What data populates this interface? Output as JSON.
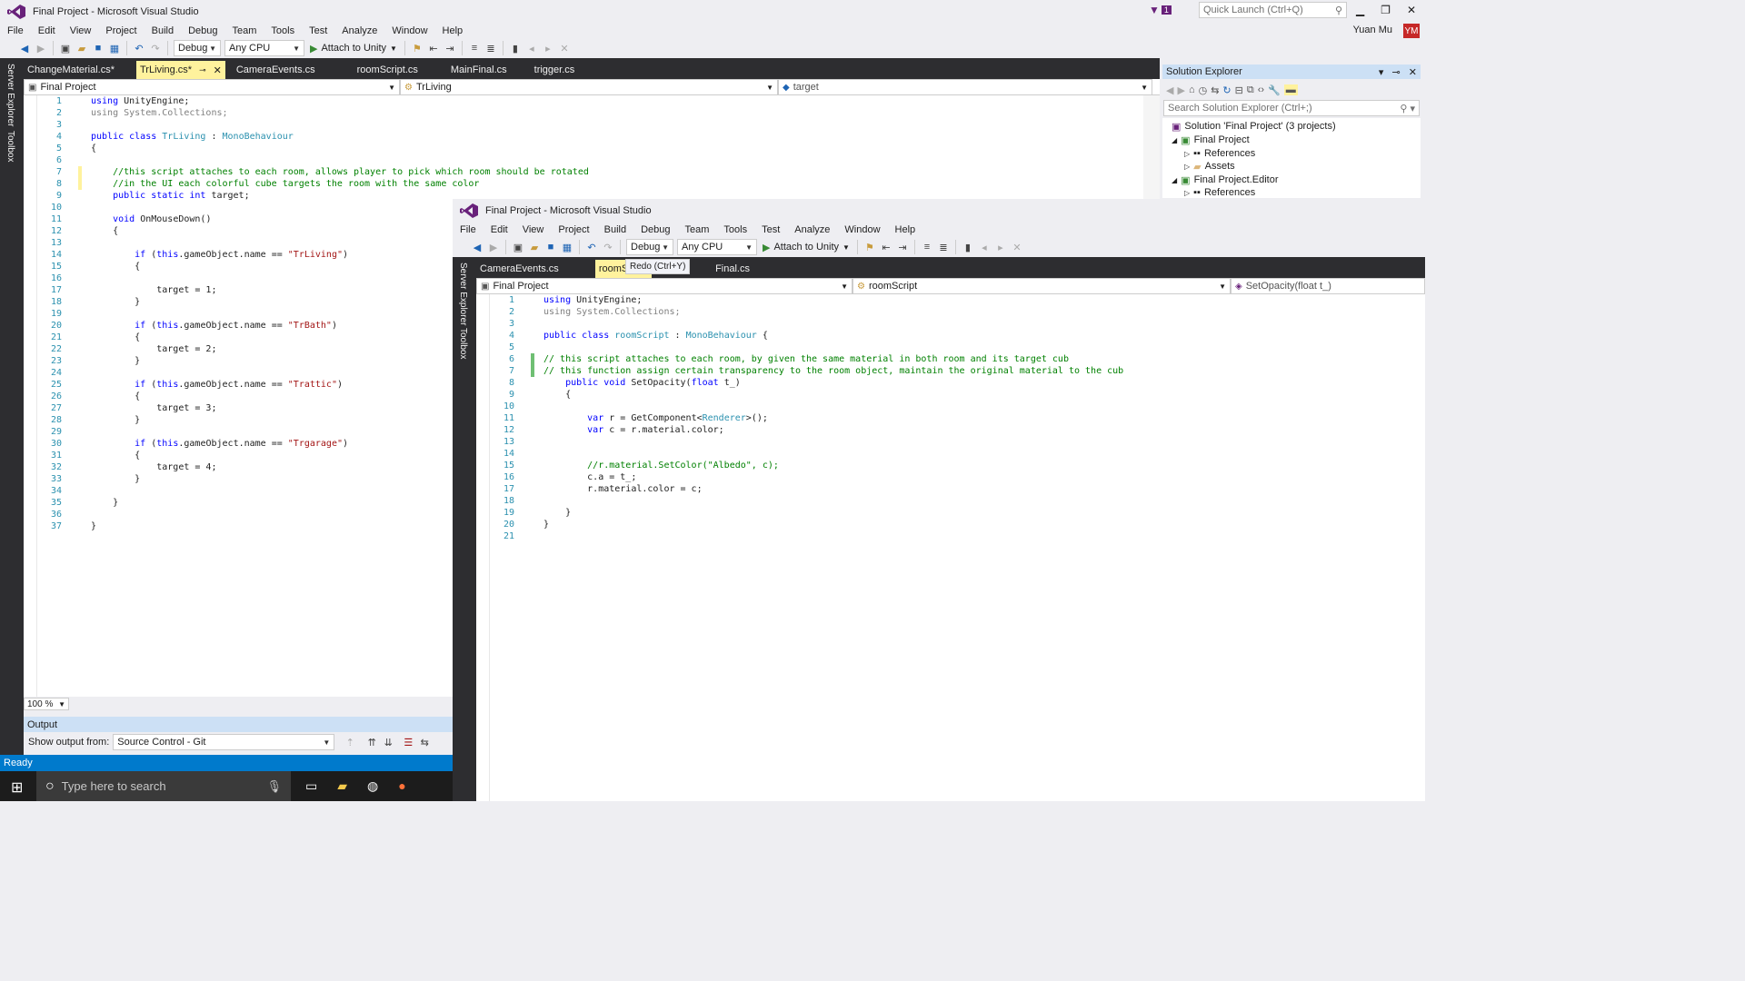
{
  "window1": {
    "title": "Final Project - Microsoft Visual Studio",
    "menu": [
      "File",
      "Edit",
      "View",
      "Project",
      "Build",
      "Debug",
      "Team",
      "Tools",
      "Test",
      "Analyze",
      "Window",
      "Help"
    ],
    "toolbar": {
      "config": "Debug",
      "platform": "Any CPU",
      "attach": "Attach to Unity"
    },
    "quick_launch_placeholder": "Quick Launch (Ctrl+Q)",
    "notification_count": "1",
    "user_name": "Yuan Mu",
    "user_initials": "YM",
    "side_tabs": [
      "Server Explorer",
      "Toolbox"
    ],
    "tabs": [
      {
        "label": "ChangeMaterial.cs*"
      },
      {
        "label": "TrLiving.cs*",
        "active": true
      },
      {
        "label": "CameraEvents.cs"
      },
      {
        "label": "roomScript.cs"
      },
      {
        "label": "MainFinal.cs"
      },
      {
        "label": "trigger.cs"
      }
    ],
    "nav": {
      "project": "Final Project",
      "class": "TrLiving",
      "member": "target"
    },
    "code_lines": [
      [
        [
          "kw",
          "using"
        ],
        [
          "pl",
          " UnityEngine;"
        ]
      ],
      [
        [
          "gy",
          "using System.Collections;"
        ]
      ],
      [],
      [
        [
          "kw",
          "public class "
        ],
        [
          "ty",
          "TrLiving"
        ],
        [
          "pl",
          " : "
        ],
        [
          "ty",
          "MonoBehaviour"
        ]
      ],
      [
        [
          "pl",
          "{"
        ]
      ],
      [],
      [
        [
          "cm",
          "    //this script attaches to each room, allows player to pick which room should be rotated"
        ]
      ],
      [
        [
          "cm",
          "    //in the UI each colorful cube targets the room with the same color"
        ]
      ],
      [
        [
          "kw",
          "    public static int"
        ],
        [
          "pl",
          " target;"
        ]
      ],
      [],
      [
        [
          "kw",
          "    void"
        ],
        [
          "pl",
          " OnMouseDown()"
        ]
      ],
      [
        [
          "pl",
          "    {"
        ]
      ],
      [],
      [
        [
          "kw",
          "        if"
        ],
        [
          "pl",
          " ("
        ],
        [
          "kw",
          "this"
        ],
        [
          "pl",
          ".gameObject.name == "
        ],
        [
          "st",
          "\"TrLiving\""
        ],
        [
          "pl",
          ")"
        ]
      ],
      [
        [
          "pl",
          "        {"
        ]
      ],
      [],
      [
        [
          "pl",
          "            target = 1;"
        ]
      ],
      [
        [
          "pl",
          "        }"
        ]
      ],
      [],
      [
        [
          "kw",
          "        if"
        ],
        [
          "pl",
          " ("
        ],
        [
          "kw",
          "this"
        ],
        [
          "pl",
          ".gameObject.name == "
        ],
        [
          "st",
          "\"TrBath\""
        ],
        [
          "pl",
          ")"
        ]
      ],
      [
        [
          "pl",
          "        {"
        ]
      ],
      [
        [
          "pl",
          "            target = 2;"
        ]
      ],
      [
        [
          "pl",
          "        }"
        ]
      ],
      [],
      [
        [
          "kw",
          "        if"
        ],
        [
          "pl",
          " ("
        ],
        [
          "kw",
          "this"
        ],
        [
          "pl",
          ".gameObject.name == "
        ],
        [
          "st",
          "\"Trattic\""
        ],
        [
          "pl",
          ")"
        ]
      ],
      [
        [
          "pl",
          "        {"
        ]
      ],
      [
        [
          "pl",
          "            target = 3;"
        ]
      ],
      [
        [
          "pl",
          "        }"
        ]
      ],
      [],
      [
        [
          "kw",
          "        if"
        ],
        [
          "pl",
          " ("
        ],
        [
          "kw",
          "this"
        ],
        [
          "pl",
          ".gameObject.name == "
        ],
        [
          "st",
          "\"Trgarage\""
        ],
        [
          "pl",
          ")"
        ]
      ],
      [
        [
          "pl",
          "        {"
        ]
      ],
      [
        [
          "pl",
          "            target = 4;"
        ]
      ],
      [
        [
          "pl",
          "        }"
        ]
      ],
      [],
      [
        [
          "pl",
          "    }"
        ]
      ],
      [],
      [
        [
          "pl",
          "}"
        ]
      ]
    ],
    "zoom": "100 %",
    "output": {
      "title": "Output",
      "show_from_label": "Show output from:",
      "source": "Source Control - Git"
    },
    "status": "Ready",
    "solution_explorer": {
      "title": "Solution Explorer",
      "search_placeholder": "Search Solution Explorer (Ctrl+;)",
      "items": [
        "Solution 'Final Project' (3 projects)",
        "Final Project",
        "References",
        "Assets",
        "Final Project.Editor",
        "References"
      ]
    },
    "taskbar": {
      "search_placeholder": "Type here to search"
    }
  },
  "window2": {
    "title": "Final Project - Microsoft Visual Studio",
    "menu": [
      "File",
      "Edit",
      "View",
      "Project",
      "Build",
      "Debug",
      "Team",
      "Tools",
      "Test",
      "Analyze",
      "Window",
      "Help"
    ],
    "toolbar": {
      "config": "Debug",
      "platform": "Any CPU",
      "attach": "Attach to Unity"
    },
    "side_tabs": [
      "Server Explorer",
      "Toolbox"
    ],
    "tabs": [
      {
        "label": "CameraEvents.cs"
      },
      {
        "label": "roomScript.",
        "active": true
      },
      {
        "label": "Final.cs"
      }
    ],
    "tooltip": "Redo (Ctrl+Y)",
    "nav": {
      "project": "Final Project",
      "class": "roomScript",
      "member": "SetOpacity(float t_)"
    },
    "code_lines": [
      [
        [
          "kw",
          "using"
        ],
        [
          "pl",
          " UnityEngine;"
        ]
      ],
      [
        [
          "gy",
          "using System.Collections;"
        ]
      ],
      [],
      [
        [
          "kw",
          "public class "
        ],
        [
          "ty",
          "roomScript"
        ],
        [
          "pl",
          " : "
        ],
        [
          "ty",
          "MonoBehaviour"
        ],
        [
          "pl",
          " {"
        ]
      ],
      [],
      [
        [
          "cm",
          "// this script attaches to each room, by given the same material in both room and its target cub"
        ]
      ],
      [
        [
          "cm",
          "// this function assign certain transparency to the room object, maintain the original material to the cub"
        ]
      ],
      [
        [
          "kw",
          "    public void"
        ],
        [
          "pl",
          " SetOpacity("
        ],
        [
          "kw",
          "float"
        ],
        [
          "pl",
          " t_)"
        ]
      ],
      [
        [
          "pl",
          "    {"
        ]
      ],
      [],
      [
        [
          "kw",
          "        var"
        ],
        [
          "pl",
          " r = GetComponent<"
        ],
        [
          "ty",
          "Renderer"
        ],
        [
          "pl",
          ">();"
        ]
      ],
      [
        [
          "kw",
          "        var"
        ],
        [
          "pl",
          " c = r.material.color;"
        ]
      ],
      [],
      [],
      [
        [
          "cm",
          "        //r.material.SetColor(\"Albedo\", c);"
        ]
      ],
      [
        [
          "pl",
          "        c.a = t_;"
        ]
      ],
      [
        [
          "pl",
          "        r.material.color = c;"
        ]
      ],
      [],
      [
        [
          "pl",
          "    }"
        ]
      ],
      [
        [
          "pl",
          "}"
        ]
      ],
      []
    ]
  },
  "colors": {
    "accent": "#007acc",
    "tab_active": "#fff29d",
    "dark_chrome": "#2d2d30",
    "keyword": "#0000ff",
    "type": "#2b91af",
    "comment": "#008000",
    "string": "#a31515"
  }
}
